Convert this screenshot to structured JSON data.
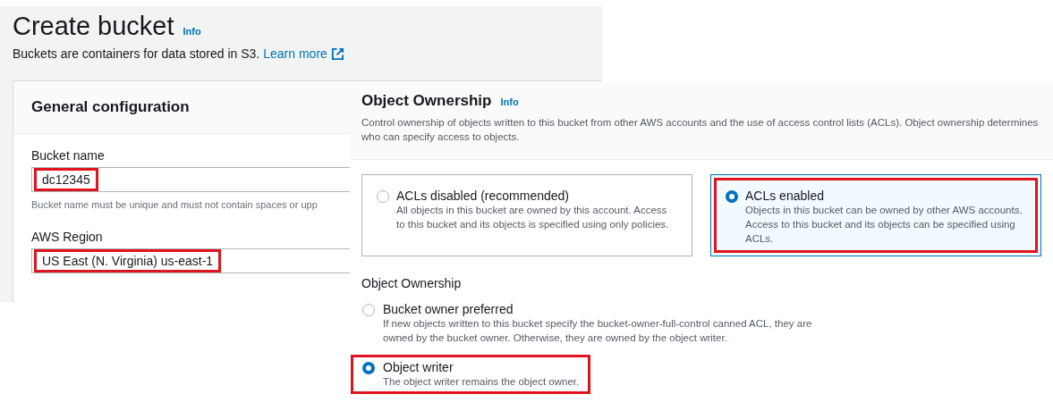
{
  "back_screen": {
    "title": "Create bucket",
    "info_link": "Info",
    "description": "Buckets are containers for data stored in S3.",
    "learn_more_link": "Learn more",
    "general_configuration": {
      "heading": "General configuration",
      "fields": [
        {
          "label": "Bucket name",
          "value": "dc12345",
          "highlighted": true,
          "hint": "Bucket name must be unique and must not contain spaces or upp"
        },
        {
          "label": "AWS Region",
          "value": "US East (N. Virginia) us-east-1",
          "highlighted": true
        }
      ]
    }
  },
  "front_screen": {
    "title": "Object Ownership",
    "info_link": "Info",
    "description": "Control ownership of objects written to this bucket from other AWS accounts and the use of access control lists (ACLs). Object ownership determines who can specify access to objects.",
    "acl_options": [
      {
        "title": "ACLs disabled (recommended)",
        "description": "All objects in this bucket are owned by this account. Access to this bucket and its objects is specified using only policies.",
        "selected": false,
        "highlighted": false
      },
      {
        "title": "ACLs enabled",
        "description": "Objects in this bucket can be owned by other AWS accounts. Access to this bucket and its objects can be specified using ACLs.",
        "selected": true,
        "highlighted": true
      }
    ],
    "ownership_label": "Object Ownership",
    "ownership_options": [
      {
        "title": "Bucket owner preferred",
        "description": "If new objects written to this bucket specify the bucket-owner-full-control canned ACL, they are owned by the bucket owner. Otherwise, they are owned by the object writer.",
        "selected": false,
        "highlighted": false
      },
      {
        "title": "Object writer",
        "description": "The object writer remains the object owner.",
        "selected": true,
        "highlighted": true
      }
    ]
  }
}
